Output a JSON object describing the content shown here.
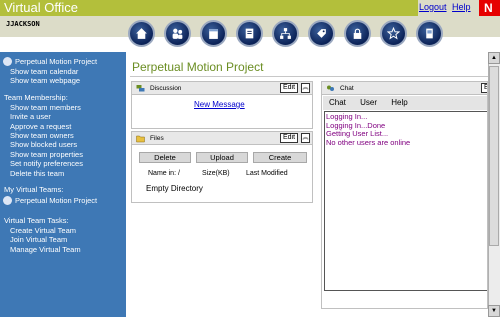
{
  "header": {
    "app_title": "Virtual Office",
    "username": "JJACKSON",
    "logout_label": "Logout",
    "help_label": "Help",
    "logo_letter": "N",
    "accent_color": "#b3bf3b"
  },
  "nav_icons": [
    "home-icon",
    "team-icon",
    "calendar-icon",
    "files-icon",
    "org-chart-icon",
    "tag-icon",
    "lock-icon",
    "star-icon",
    "document-icon"
  ],
  "sidebar": {
    "project_name": "Perpetual Motion Project",
    "project_items": [
      "Show team calendar",
      "Show team webpage"
    ],
    "membership_heading": "Team Membership:",
    "membership_items": [
      "Show team members",
      "Invite a user",
      "Approve a request",
      "Show team owners",
      "Show blocked users",
      "Show team properties",
      "Set notify preferences",
      "Delete this team"
    ],
    "my_teams_heading": "My Virtual Teams:",
    "my_teams_item": "Perpetual Motion Project",
    "tasks_heading": "Virtual Team Tasks:",
    "task_items": [
      "Create Virtual Team",
      "Join Virtual Team",
      "Manage Virtual Team"
    ]
  },
  "main": {
    "page_title": "Perpetual Motion Project",
    "discussion": {
      "title": "Discussion",
      "edit_label": "Edit",
      "new_message_label": "New Message"
    },
    "files": {
      "title": "Files",
      "edit_label": "Edit",
      "buttons": [
        "Delete",
        "Upload",
        "Create"
      ],
      "name_in_label": "Name in:",
      "path": "/",
      "size_label": "Size(KB)",
      "modified_label": "Last Modified",
      "empty_label": "Empty Directory"
    },
    "chat": {
      "title": "Chat",
      "edit_label": "E",
      "menu": [
        "Chat",
        "User",
        "Help"
      ],
      "log": [
        "Logging In...",
        "Logging In...Done",
        "Getting User List...",
        "No other users are online"
      ]
    }
  }
}
